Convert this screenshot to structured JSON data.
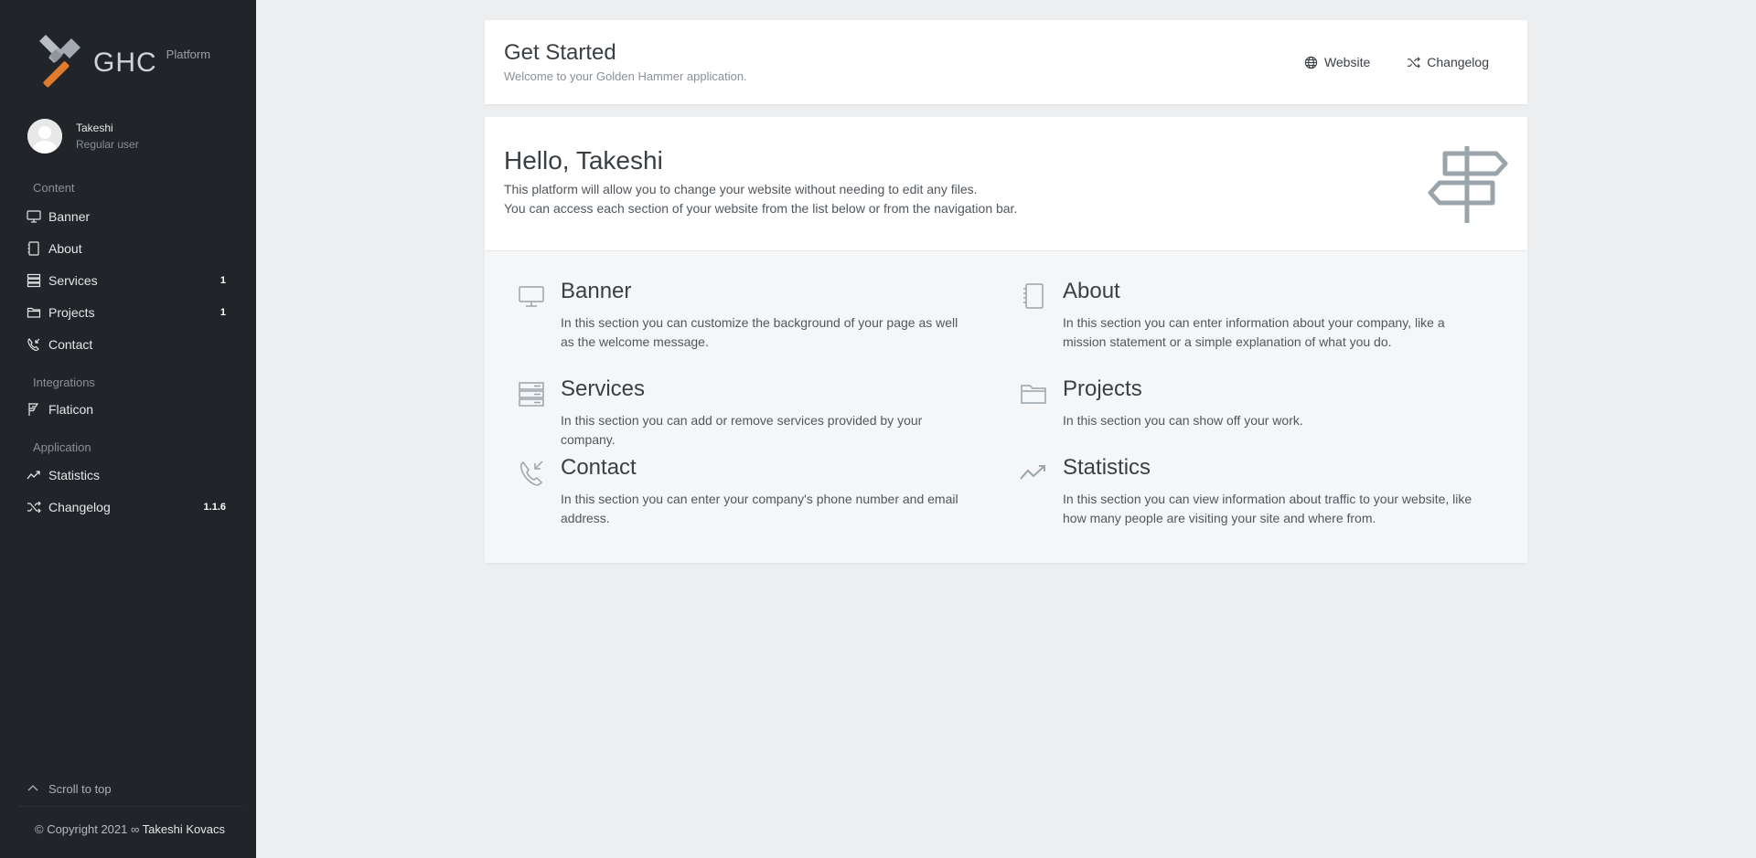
{
  "brand": {
    "name": "GHC",
    "sub": "Platform"
  },
  "user": {
    "name": "Takeshi",
    "role": "Regular user"
  },
  "sidebar": {
    "sections": [
      {
        "title": "Content"
      },
      {
        "title": "Integrations"
      },
      {
        "title": "Application"
      }
    ],
    "items": [
      {
        "label": "Banner",
        "icon": "monitor-icon",
        "badge": ""
      },
      {
        "label": "About",
        "icon": "notebook-icon",
        "badge": ""
      },
      {
        "label": "Services",
        "icon": "server-icon",
        "badge": "1"
      },
      {
        "label": "Projects",
        "icon": "folder-icon",
        "badge": "1"
      },
      {
        "label": "Contact",
        "icon": "phone-incoming-icon",
        "badge": ""
      },
      {
        "label": "Flaticon",
        "icon": "flag-icon",
        "badge": ""
      },
      {
        "label": "Statistics",
        "icon": "trending-icon",
        "badge": ""
      },
      {
        "label": "Changelog",
        "icon": "shuffle-icon",
        "badge": "1.1.6"
      }
    ],
    "scroll_top": "Scroll to top",
    "copyright": "© Copyright 2021 ∞",
    "copyright_author": "Takeshi Kovacs"
  },
  "header": {
    "title": "Get Started",
    "subtitle": "Welcome to your Golden Hammer application.",
    "links": [
      {
        "label": "Website",
        "icon": "globe-icon"
      },
      {
        "label": "Changelog",
        "icon": "shuffle-icon"
      }
    ]
  },
  "main": {
    "greeting": "Hello, Takeshi",
    "intro_line1": "This platform will allow you to change your website without needing to edit any files.",
    "intro_line2": "You can access each section of your website from the list below or from the navigation bar.",
    "features": [
      {
        "title": "Banner",
        "desc": "In this section you can customize the background of your page as well as the welcome message."
      },
      {
        "title": "About",
        "desc": "In this section you can enter information about your company, like a mission statement or a simple explanation of what you do."
      },
      {
        "title": "Services",
        "desc": "In this section you can add or remove services provided by your company."
      },
      {
        "title": "Projects",
        "desc": "In this section you can show off your work."
      },
      {
        "title": "Contact",
        "desc": "In this section you can enter your company's phone number and email address."
      },
      {
        "title": "Statistics",
        "desc": "In this section you can view information about traffic to your website, like how many people are visiting your site and where from."
      }
    ]
  },
  "colors": {
    "sidebar_bg": "#212529",
    "page_bg": "#eceef0",
    "card_bg": "#ffffff",
    "icon_grey": "#9aa4ab"
  }
}
